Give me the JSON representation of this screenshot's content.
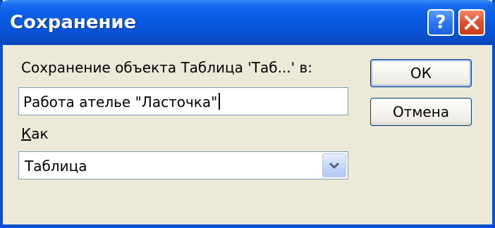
{
  "window": {
    "title": "Сохранение",
    "help_glyph": "?",
    "help_icon": "help-icon",
    "close_icon": "close-icon"
  },
  "form": {
    "save_label": "Сохранение объекта Таблица 'Таб...' в:",
    "name_value": "Работа ателье \"Ласточка\"",
    "as_label_underlined": "К",
    "as_label_rest": "ак",
    "type_value": "Таблица"
  },
  "buttons": {
    "ok": "ОК",
    "cancel": "Отмена"
  },
  "colors": {
    "titlebar": "#0854d9",
    "face": "#ece9d8",
    "close": "#e0502a"
  }
}
